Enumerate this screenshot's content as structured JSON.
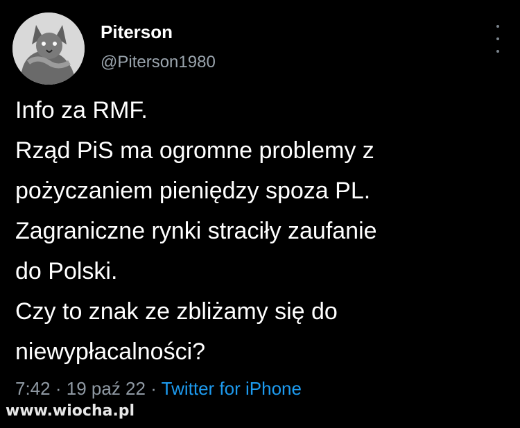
{
  "author": {
    "display_name": "Piterson",
    "handle": "@Piterson1980"
  },
  "tweet": {
    "lines": [
      "Info za RMF.",
      "Rząd PiS ma ogromne problemy z",
      "pożyczaniem pieniędzy spoza PL.",
      "Zagraniczne rynki straciły zaufanie",
      "do Polski.",
      "Czy to znak ze zbliżamy się do",
      "niewypłacalności?"
    ]
  },
  "meta": {
    "time": "7:42",
    "date": "19 paź 22",
    "separator": "·",
    "source": "Twitter for iPhone"
  },
  "watermark": "www.wiocha.pl",
  "icons": {
    "avatar": "cat-avatar-icon",
    "more": "more-options-icon"
  },
  "colors": {
    "background": "#000000",
    "primary_text": "#ffffff",
    "secondary_text": "#8f99a3",
    "link": "#1d9bf0"
  }
}
